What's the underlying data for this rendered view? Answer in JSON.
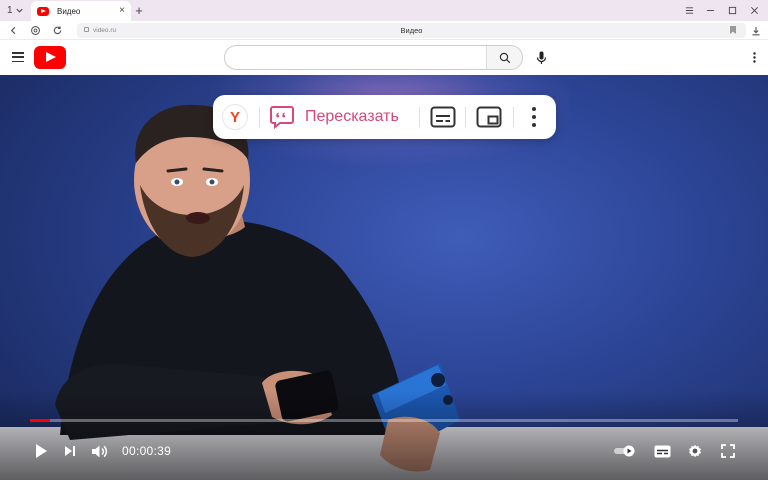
{
  "browser": {
    "tab_count": "1",
    "tab_title": "Видео",
    "close_symbol": "×",
    "new_tab_symbol": "+",
    "url": "video.ru",
    "page_title": "Видео"
  },
  "site": {
    "search_placeholder": ""
  },
  "overlay": {
    "logo_letter": "Y",
    "retell_label": "Пересказать"
  },
  "player": {
    "time": "00:00:39",
    "progress_fraction": 0.028
  },
  "colors": {
    "brand_red": "#ff0000",
    "yandex_red": "#fc3f1d",
    "retell_pink": "#d9487a"
  }
}
